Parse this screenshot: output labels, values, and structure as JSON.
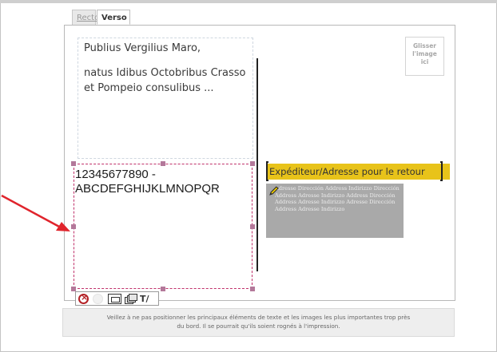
{
  "tabs": {
    "recto": "Recto",
    "verso": "Verso"
  },
  "sender": {
    "line1": "Publius Vergilius Maro,",
    "line2": "natus Idibus Octobribus Crasso",
    "line3": "et Pompeio consulibus ..."
  },
  "stamp": {
    "line1": "Glisser",
    "line2": "l'image",
    "line3": "ici"
  },
  "selected_text": {
    "line1": "12345677890 -",
    "line2": "ABCDEFGHIJKLMNOPQR"
  },
  "return_address": {
    "label": "Expéditeur/Adresse pour le retour",
    "placeholder_text": "Adresse Dirección Address Indirizzo Dirección Address Adresse Indirizzo Address Dirección Address Adresse Indirizzo Adresse Dirección Address Adresse Indirizzo"
  },
  "toolbar": {
    "icons": [
      "close-icon",
      "circle-icon",
      "fit-icon",
      "layers-icon",
      "text-edit-icon"
    ],
    "edit_glyph": "T/"
  },
  "footer": {
    "line1": "Veillez à ne pas positionner les principaux éléments de texte et les images les plus importantes trop près",
    "line2": "du bord. Il se pourrait qu'ils soient rognés à l'impression."
  },
  "colors": {
    "return_label_bg": "#e8c31a",
    "selection_border": "#c0306a",
    "arrow": "#e0242c",
    "close_icon": "#b32025"
  }
}
